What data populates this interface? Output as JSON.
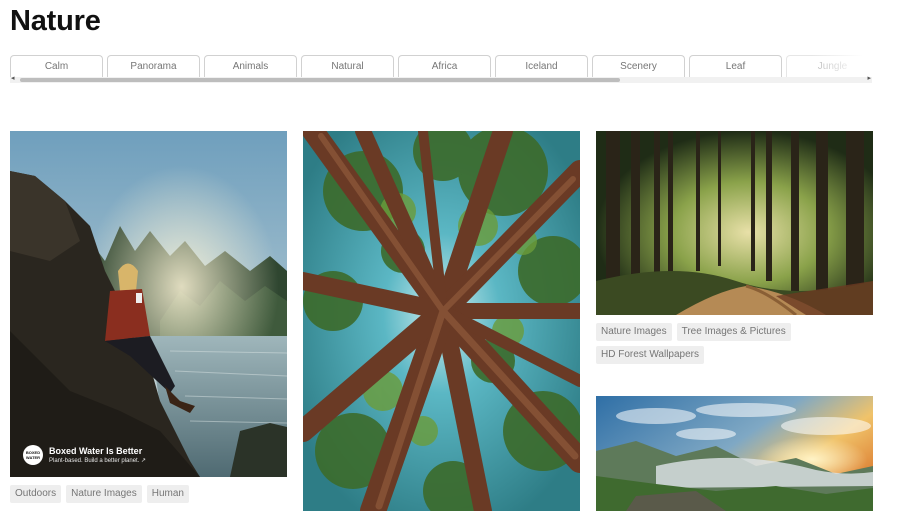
{
  "page": {
    "title": "Nature"
  },
  "tags": [
    "Calm",
    "Panorama",
    "Animals",
    "Natural",
    "Africa",
    "Iceland",
    "Scenery",
    "Leaf",
    "Jungle"
  ],
  "columns": {
    "left": {
      "sponsor": {
        "logo": "BOXED WATER",
        "name": "Boxed Water Is Better",
        "tagline": "Plant-based. Build a better planet. ↗"
      },
      "badges": [
        "Outdoors",
        "Nature Images",
        "Human"
      ]
    },
    "middle": {},
    "right": {
      "badges": [
        "Nature Images",
        "Tree Images & Pictures",
        "HD Forest Wallpapers"
      ]
    }
  },
  "colors": {
    "accent_badge_bg": "#eeeeee",
    "badge_text": "#767676"
  }
}
